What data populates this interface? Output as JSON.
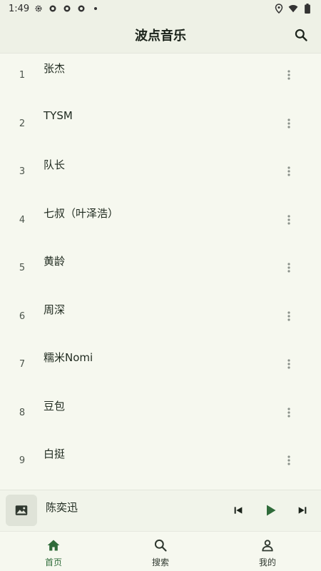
{
  "status_bar": {
    "time": "1:49"
  },
  "app_bar": {
    "title": "波点音乐"
  },
  "songs": [
    {
      "index": "1",
      "name": "张杰"
    },
    {
      "index": "2",
      "name": "TYSM"
    },
    {
      "index": "3",
      "name": "队长"
    },
    {
      "index": "4",
      "name": "七叔（叶泽浩）"
    },
    {
      "index": "5",
      "name": "黄龄"
    },
    {
      "index": "6",
      "name": "周深"
    },
    {
      "index": "7",
      "name": "糯米Nomi"
    },
    {
      "index": "8",
      "name": "豆包"
    },
    {
      "index": "9",
      "name": "白挺"
    }
  ],
  "mini_player": {
    "title": "陈奕迅"
  },
  "bottom_nav": {
    "items": [
      {
        "label": "首页",
        "icon": "home-icon",
        "active": true
      },
      {
        "label": "搜索",
        "icon": "search-icon",
        "active": false
      },
      {
        "label": "我的",
        "icon": "person-icon",
        "active": false
      }
    ]
  },
  "colors": {
    "accent": "#2f6b3a",
    "background": "#f6f8ef",
    "bar": "#eef1e6"
  }
}
